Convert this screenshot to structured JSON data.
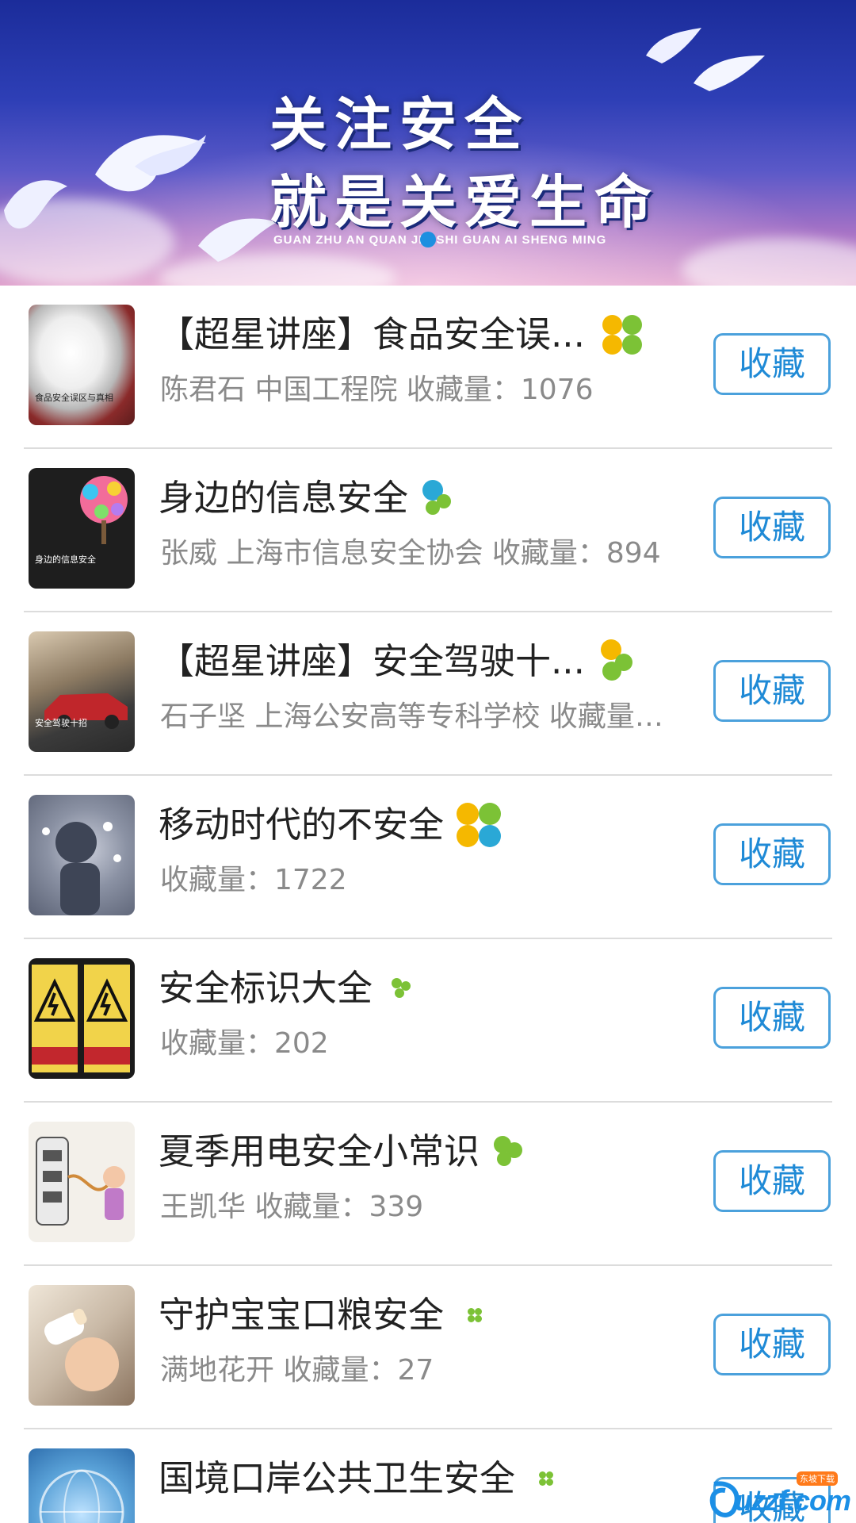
{
  "banner": {
    "line1": "关注安全",
    "line2": "就是关爱生命",
    "pinyin": "GUAN ZHU AN QUAN JIU SHI GUAN AI SHENG MING"
  },
  "items": [
    {
      "title": "【超星讲座】食品安全误...",
      "subtitle": "陈君石 中国工程院  收藏量：1076",
      "thumb_caption": "食品安全误区与真相",
      "button": "收藏",
      "clover_colors": [
        "#f5b800",
        "#f5b800",
        "#7cc236",
        "#7cc236"
      ],
      "thumb_bg": "#6b2d2d"
    },
    {
      "title": "身边的信息安全",
      "subtitle": "张威 上海市信息安全协会  收藏量：894",
      "thumb_caption": "身边的信息安全",
      "button": "收藏",
      "clover_colors": [
        "#2aa8d6",
        "#2aa8d6",
        "#7cc236",
        "#7cc236"
      ],
      "thumb_bg": "#1e1e1e"
    },
    {
      "title": "【超星讲座】安全驾驶十...",
      "subtitle": "石子坚 上海公安高等专科学校  收藏量：...",
      "thumb_caption": "安全驾驶十招",
      "button": "收藏",
      "clover_colors": [
        "#f5b800",
        "#f5b800",
        "#7cc236",
        "#7cc236"
      ],
      "thumb_bg": "#5a4a3a"
    },
    {
      "title": "移动时代的不安全",
      "subtitle": " 收藏量：1722",
      "thumb_caption": "",
      "button": "收藏",
      "clover_colors": [
        "#f5b800",
        "#7cc236",
        "#f5b800",
        "#2aa8d6"
      ],
      "thumb_bg": "#8e96a8"
    },
    {
      "title": "安全标识大全",
      "subtitle": " 收藏量：202",
      "thumb_caption": "",
      "button": "收藏",
      "clover_colors": [
        "#7cc236",
        "#7cc236",
        "#7cc236",
        "#7cc236"
      ],
      "thumb_bg": "#222222"
    },
    {
      "title": "夏季用电安全小常识",
      "subtitle": "王凯华  收藏量：339",
      "thumb_caption": "",
      "button": "收藏",
      "clover_colors": [
        "#7cc236",
        "#7cc236",
        "#7cc236",
        "#7cc236"
      ],
      "thumb_bg": "#f3f0ea"
    },
    {
      "title": "守护宝宝口粮安全",
      "subtitle": "满地花开  收藏量：27",
      "thumb_caption": "",
      "button": "收藏",
      "clover_colors": [
        "#7cc236",
        "#7cc236",
        "#7cc236",
        "#7cc236"
      ],
      "thumb_bg": "#c9b9a6"
    },
    {
      "title": "国境口岸公共卫生安全",
      "subtitle": "",
      "thumb_caption": "",
      "button": "收藏",
      "clover_colors": [
        "#7cc236",
        "#7cc236",
        "#7cc236",
        "#7cc236"
      ],
      "thumb_bg": "#5aa2d8"
    }
  ],
  "watermark": {
    "text": "uzzf.com",
    "badge": "东坡下载"
  },
  "colors": {
    "accent": "#1f8ad6",
    "button_border": "#4ba1dc",
    "divider": "#dcdcdc",
    "subtitle": "#8a8a8a"
  }
}
